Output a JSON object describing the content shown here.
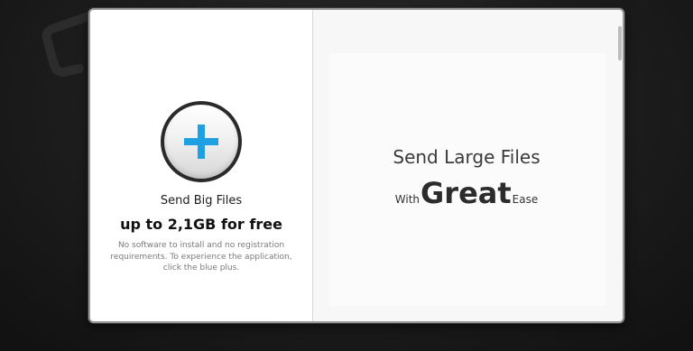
{
  "upload": {
    "button_icon": "plus-icon",
    "title": "Send Big Files",
    "limit": "up to 2,1GB for free",
    "description": "No software to install and no registration requirements. To experience the application, click the blue plus."
  },
  "promo": {
    "headline": "Send Large Files",
    "tagline_prefix": "With",
    "tagline_emphasis": "Great",
    "tagline_suffix": "Ease"
  },
  "colors": {
    "accent_blue": "#1ea0e2",
    "background": "#1d1d1d"
  }
}
